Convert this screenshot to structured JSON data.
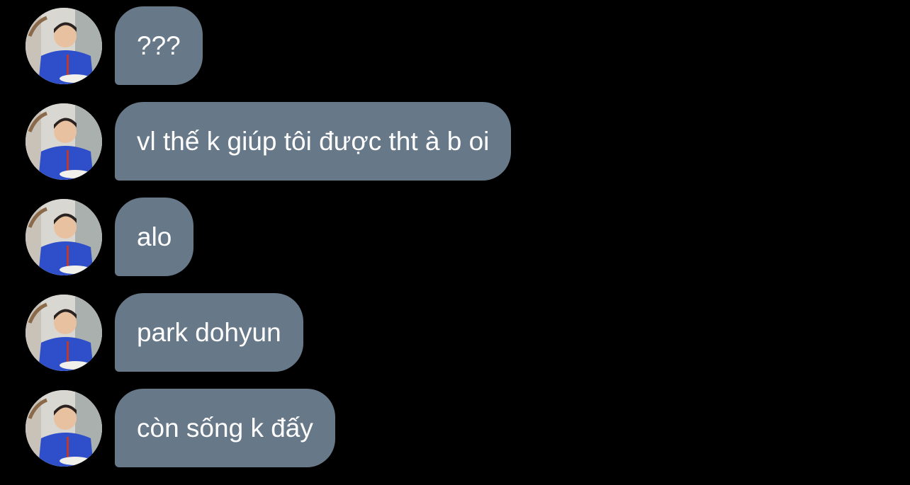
{
  "conversation": {
    "bubble_color": "#677889",
    "background_color": "#000000",
    "messages": [
      {
        "text": "???"
      },
      {
        "text": "vl thế k giúp tôi được tht à b oi"
      },
      {
        "text": "alo"
      },
      {
        "text": "park dohyun"
      },
      {
        "text": "còn sống k đấy"
      }
    ]
  }
}
